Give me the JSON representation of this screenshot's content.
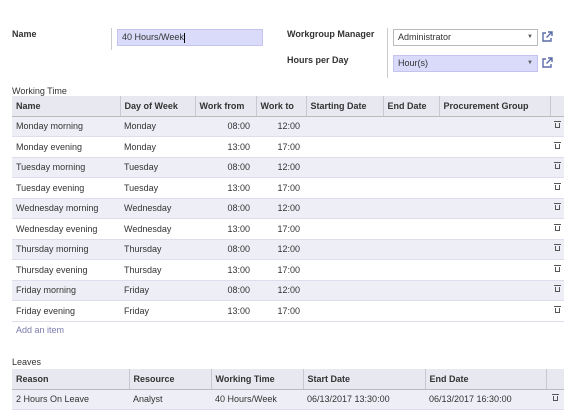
{
  "form": {
    "name_label": "Name",
    "name_value": "40 Hours/Week",
    "manager_label": "Workgroup Manager",
    "manager_value": "Administrator",
    "hours_label": "Hours per Day",
    "hours_value": "Hour(s)"
  },
  "working_time": {
    "title": "Working Time",
    "columns": [
      "Name",
      "Day of Week",
      "Work from",
      "Work to",
      "Starting Date",
      "End Date",
      "Procurement Group"
    ],
    "rows": [
      [
        "Monday morning",
        "Monday",
        "08:00",
        "12:00",
        "",
        "",
        ""
      ],
      [
        "Monday evening",
        "Monday",
        "13:00",
        "17:00",
        "",
        "",
        ""
      ],
      [
        "Tuesday morning",
        "Tuesday",
        "08:00",
        "12:00",
        "",
        "",
        ""
      ],
      [
        "Tuesday evening",
        "Tuesday",
        "13:00",
        "17:00",
        "",
        "",
        ""
      ],
      [
        "Wednesday morning",
        "Wednesday",
        "08:00",
        "12:00",
        "",
        "",
        ""
      ],
      [
        "Wednesday evening",
        "Wednesday",
        "13:00",
        "17:00",
        "",
        "",
        ""
      ],
      [
        "Thursday morning",
        "Thursday",
        "08:00",
        "12:00",
        "",
        "",
        ""
      ],
      [
        "Thursday evening",
        "Thursday",
        "13:00",
        "17:00",
        "",
        "",
        ""
      ],
      [
        "Friday morning",
        "Friday",
        "08:00",
        "12:00",
        "",
        "",
        ""
      ],
      [
        "Friday evening",
        "Friday",
        "13:00",
        "17:00",
        "",
        "",
        ""
      ]
    ],
    "add_item": "Add an item"
  },
  "leaves": {
    "title": "Leaves",
    "columns": [
      "Reason",
      "Resource",
      "Working Time",
      "Start Date",
      "End Date"
    ],
    "rows": [
      [
        "2 Hours On Leave",
        "Analyst",
        "40 Hours/Week",
        "06/13/2017 13:30:00",
        "06/13/2017 16:30:00"
      ]
    ]
  },
  "colors": {
    "accent": "#7c7bad",
    "highlight_input": "#dadafa",
    "row_stripe": "#eeeef6",
    "header_bg": "#e8e8f0"
  },
  "icons": {
    "external_link": "external-link-icon",
    "trash": "trash-icon",
    "dropdown": "caret-down-icon"
  }
}
